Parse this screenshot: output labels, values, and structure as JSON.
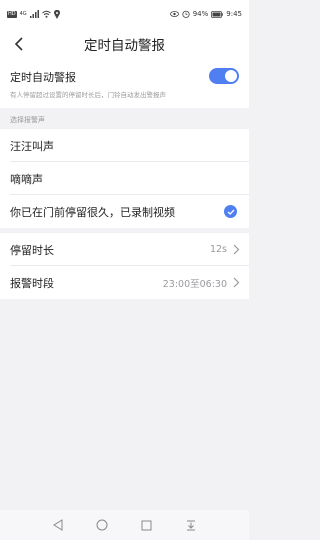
{
  "status_bar": {
    "left_box": "HD",
    "left_signal_label": "4G",
    "battery": "94%",
    "time": "9:45"
  },
  "nav": {
    "title": "定时自动警报"
  },
  "timed_alarm": {
    "label": "定时自动警报",
    "description": "有人停留超过设置的停留时长后，门铃自动发出警报声",
    "enabled": true
  },
  "sound_section": {
    "label": "选择报警声",
    "options": [
      {
        "label": "汪汪叫声",
        "selected": false
      },
      {
        "label": "嘀嘀声",
        "selected": false
      },
      {
        "label": "你已在门前停留很久，已录制视频",
        "selected": true
      }
    ]
  },
  "settings": {
    "stay_duration": {
      "label": "停留时长",
      "value": "12s"
    },
    "alarm_period": {
      "label": "报警时段",
      "value": "23:00至06:30"
    }
  },
  "colors": {
    "accent": "#4f7ff0",
    "background": "#f2f2f4"
  }
}
